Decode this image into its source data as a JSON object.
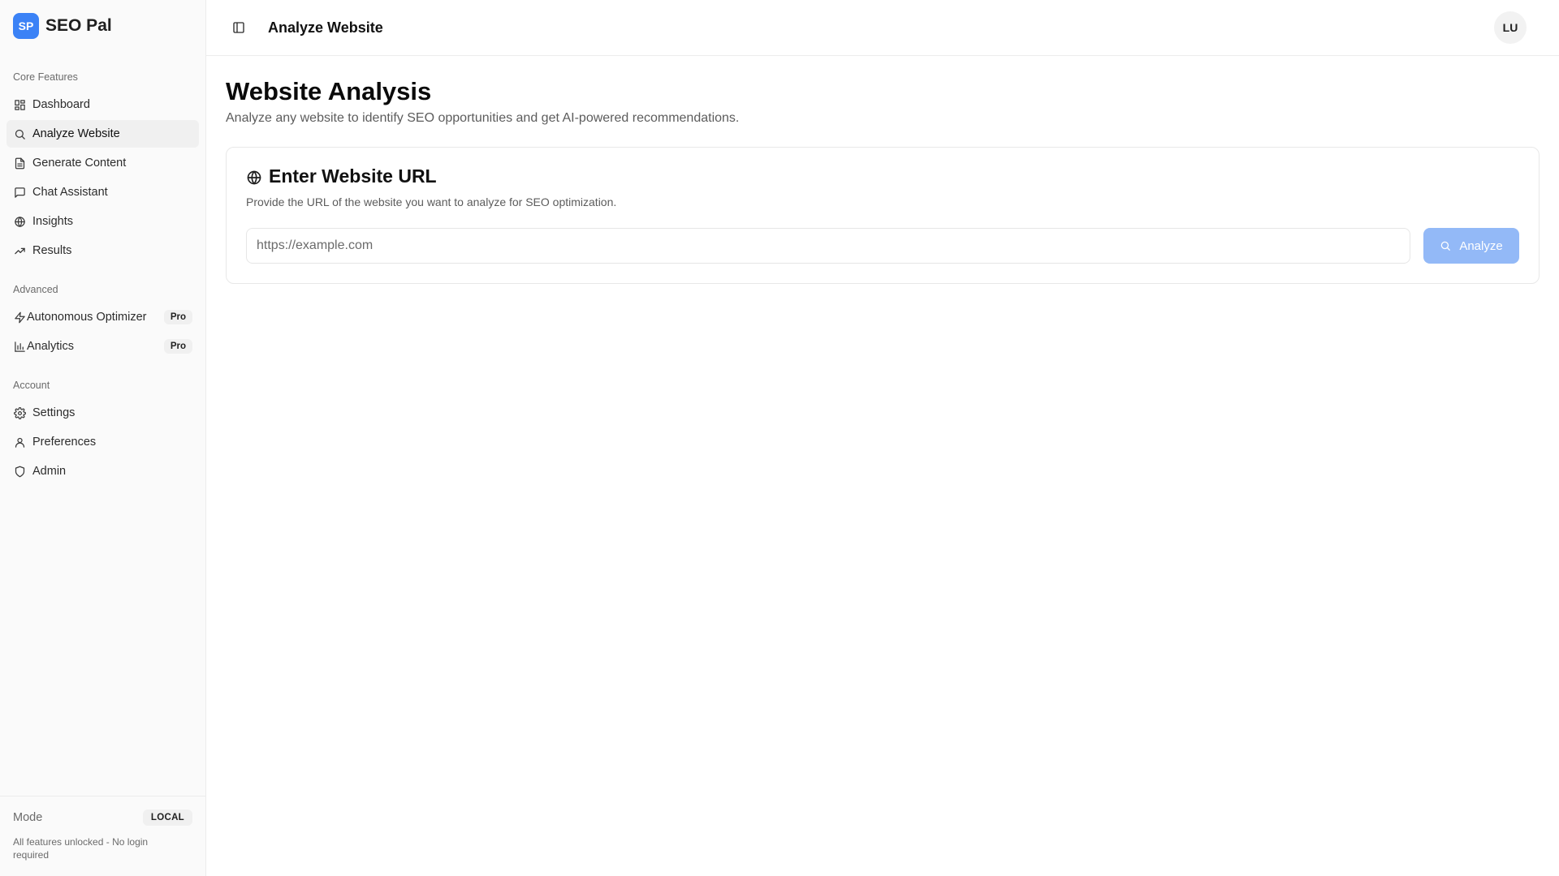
{
  "brand": {
    "badge": "SP",
    "name": "SEO Pal",
    "accent": "#3b82f6"
  },
  "sidebar": {
    "groups": [
      {
        "label": "Core Features",
        "items": [
          {
            "label": "Dashboard",
            "icon": "dashboard-icon"
          },
          {
            "label": "Analyze Website",
            "icon": "search-icon",
            "active": true
          },
          {
            "label": "Generate Content",
            "icon": "file-text-icon"
          },
          {
            "label": "Chat Assistant",
            "icon": "message-square-icon"
          },
          {
            "label": "Insights",
            "icon": "globe-icon"
          },
          {
            "label": "Results",
            "icon": "trending-up-icon"
          }
        ]
      },
      {
        "label": "Advanced",
        "items": [
          {
            "label": "Autonomous Optimizer",
            "icon": "zap-icon",
            "badge": "Pro"
          },
          {
            "label": "Analytics",
            "icon": "bar-chart-icon",
            "badge": "Pro"
          }
        ]
      },
      {
        "label": "Account",
        "items": [
          {
            "label": "Settings",
            "icon": "gear-icon"
          },
          {
            "label": "Preferences",
            "icon": "user-icon"
          },
          {
            "label": "Admin",
            "icon": "shield-icon"
          }
        ]
      }
    ],
    "footer": {
      "mode_label": "Mode",
      "mode_value": "LOCAL",
      "description": "All features unlocked - No login required"
    }
  },
  "topbar": {
    "title": "Analyze Website",
    "avatar": "LU"
  },
  "page": {
    "title": "Website Analysis",
    "subtitle": "Analyze any website to identify SEO opportunities and get AI-powered recommendations."
  },
  "card": {
    "title": "Enter Website URL",
    "description": "Provide the URL of the website you want to analyze for SEO optimization.",
    "input_placeholder": "https://example.com",
    "input_value": "",
    "button_label": "Analyze",
    "button_color": "#93b9f7"
  }
}
